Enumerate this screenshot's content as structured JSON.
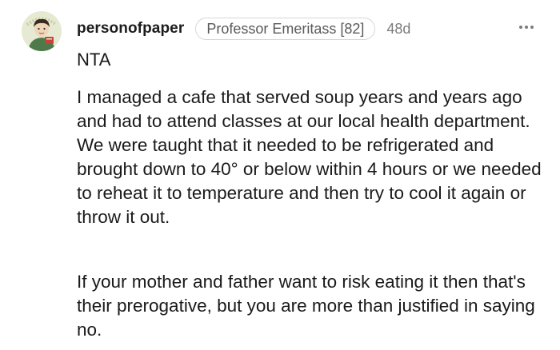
{
  "comment": {
    "author": {
      "username": "personofpaper",
      "flair": "Professor Emeritass [82]",
      "age": "48d",
      "avatar_icon": "avatar-icon"
    },
    "more_icon": "more-options-icon",
    "verdict": "NTA",
    "paragraphs": [
      "I managed a cafe that served soup years and years ago and had to attend classes at our local health department. We were taught that it needed to be refrigerated and brought down to 40° or below within 4 hours or we needed to reheat it to temperature and then try to cool it again or throw it out.",
      "If your mother and father want to risk eating it then that's their prerogative, but you are more than justified in saying no."
    ]
  }
}
